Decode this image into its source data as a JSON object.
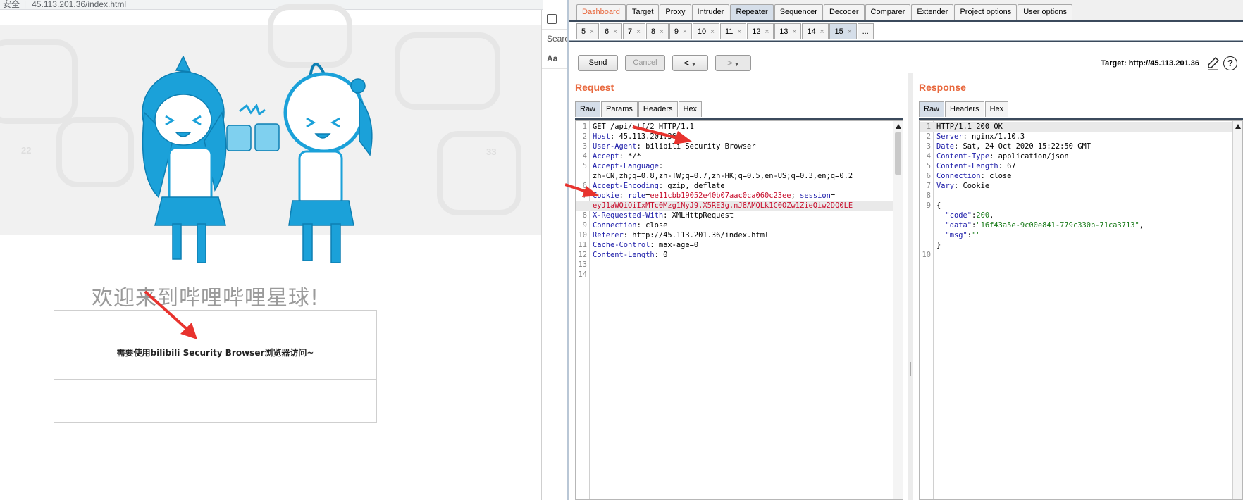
{
  "browser": {
    "url_prefix": "安全",
    "url": "45.113.201.36/index.html",
    "welcome": "欢迎来到哔哩哔哩星球!",
    "message": "需要使用bilibili Security Browser浏览器访问~",
    "devtools": {
      "search_label": "Searc",
      "aa_label": "Aa"
    }
  },
  "burp": {
    "main_tabs": [
      {
        "label": "Dashboard",
        "state": "alert"
      },
      {
        "label": "Target"
      },
      {
        "label": "Proxy"
      },
      {
        "label": "Intruder"
      },
      {
        "label": "Repeater",
        "state": "active"
      },
      {
        "label": "Sequencer"
      },
      {
        "label": "Decoder"
      },
      {
        "label": "Comparer"
      },
      {
        "label": "Extender"
      },
      {
        "label": "Project options"
      },
      {
        "label": "User options"
      }
    ],
    "repeater_tabs": [
      "5",
      "6",
      "7",
      "8",
      "9",
      "10",
      "11",
      "12",
      "13",
      "14",
      "15"
    ],
    "repeater_active": "15",
    "repeater_more": "...",
    "toolbar": {
      "send": "Send",
      "cancel": "Cancel",
      "back": "<",
      "forward": ">",
      "target_label": "Target: http://45.113.201.36"
    },
    "request": {
      "title": "Request",
      "tabs": [
        "Raw",
        "Params",
        "Headers",
        "Hex"
      ],
      "lines": [
        {
          "n": "1",
          "parts": [
            {
              "t": "GET /api/ctf/2 HTTP/1.1",
              "c": "v"
            }
          ]
        },
        {
          "n": "2",
          "parts": [
            {
              "t": "Host",
              "c": "k"
            },
            {
              "t": ": 45.113.201.36",
              "c": "v"
            }
          ]
        },
        {
          "n": "3",
          "parts": [
            {
              "t": "User-Agent",
              "c": "k"
            },
            {
              "t": ": bilibili Security Browser",
              "c": "v"
            }
          ]
        },
        {
          "n": "4",
          "parts": [
            {
              "t": "Accept",
              "c": "k"
            },
            {
              "t": ": */*",
              "c": "v"
            }
          ]
        },
        {
          "n": "5",
          "parts": [
            {
              "t": "Accept-Language",
              "c": "k"
            },
            {
              "t": ":",
              "c": "v"
            }
          ]
        },
        {
          "n": "",
          "parts": [
            {
              "t": "zh-CN,zh;q=0.8,zh-TW;q=0.7,zh-HK;q=0.5,en-US;q=0.3,en;q=0.2",
              "c": "v"
            }
          ]
        },
        {
          "n": "6",
          "parts": [
            {
              "t": "Accept-Encoding",
              "c": "k"
            },
            {
              "t": ": gzip, deflate",
              "c": "v"
            }
          ]
        },
        {
          "n": "7",
          "parts": [
            {
              "t": "Cookie",
              "c": "k"
            },
            {
              "t": ": ",
              "c": "v"
            },
            {
              "t": "role",
              "c": "k"
            },
            {
              "t": "=",
              "c": "v"
            },
            {
              "t": "ee11cbb19052e40b07aac0ca060c23ee",
              "c": "r"
            },
            {
              "t": "; ",
              "c": "v"
            },
            {
              "t": "session",
              "c": "k"
            },
            {
              "t": "=",
              "c": "v"
            }
          ]
        },
        {
          "n": "",
          "hl": true,
          "parts": [
            {
              "t": "eyJ1aWQiOiIxMTc0Mzg1NyJ9.X5RE3g.nJ8AMQLk1C0OZw1ZieQiw2DQ0LE",
              "c": "r"
            }
          ]
        },
        {
          "n": "8",
          "parts": [
            {
              "t": "X-Requested-With",
              "c": "k"
            },
            {
              "t": ": XMLHttpRequest",
              "c": "v"
            }
          ]
        },
        {
          "n": "9",
          "parts": [
            {
              "t": "Connection",
              "c": "k"
            },
            {
              "t": ": close",
              "c": "v"
            }
          ]
        },
        {
          "n": "10",
          "parts": [
            {
              "t": "Referer",
              "c": "k"
            },
            {
              "t": ": http://45.113.201.36/index.html",
              "c": "v"
            }
          ]
        },
        {
          "n": "11",
          "parts": [
            {
              "t": "Cache-Control",
              "c": "k"
            },
            {
              "t": ": max-age=0",
              "c": "v"
            }
          ]
        },
        {
          "n": "12",
          "parts": [
            {
              "t": "Content-Length",
              "c": "k"
            },
            {
              "t": ": 0",
              "c": "v"
            }
          ]
        },
        {
          "n": "13",
          "parts": []
        },
        {
          "n": "14",
          "parts": []
        }
      ]
    },
    "response": {
      "title": "Response",
      "tabs": [
        "Raw",
        "Headers",
        "Hex"
      ],
      "lines": [
        {
          "n": "1",
          "hl": true,
          "parts": [
            {
              "t": "HTTP/1.1 200 OK",
              "c": "v"
            }
          ]
        },
        {
          "n": "2",
          "parts": [
            {
              "t": "Server",
              "c": "k"
            },
            {
              "t": ": nginx/1.10.3",
              "c": "v"
            }
          ]
        },
        {
          "n": "3",
          "parts": [
            {
              "t": "Date",
              "c": "k"
            },
            {
              "t": ": Sat, 24 Oct 2020 15:22:50 GMT",
              "c": "v"
            }
          ]
        },
        {
          "n": "4",
          "parts": [
            {
              "t": "Content-Type",
              "c": "k"
            },
            {
              "t": ": application/json",
              "c": "v"
            }
          ]
        },
        {
          "n": "5",
          "parts": [
            {
              "t": "Content-Length",
              "c": "k"
            },
            {
              "t": ": 67",
              "c": "v"
            }
          ]
        },
        {
          "n": "6",
          "parts": [
            {
              "t": "Connection",
              "c": "k"
            },
            {
              "t": ": close",
              "c": "v"
            }
          ]
        },
        {
          "n": "7",
          "parts": [
            {
              "t": "Vary",
              "c": "k"
            },
            {
              "t": ": Cookie",
              "c": "v"
            }
          ]
        },
        {
          "n": "8",
          "parts": []
        },
        {
          "n": "9",
          "parts": [
            {
              "t": "{",
              "c": "v"
            }
          ]
        },
        {
          "n": "",
          "parts": [
            {
              "t": "  \"code\"",
              "c": "k"
            },
            {
              "t": ":",
              "c": "v"
            },
            {
              "t": "200",
              "c": "g"
            },
            {
              "t": ",",
              "c": "v"
            }
          ]
        },
        {
          "n": "",
          "parts": [
            {
              "t": "  \"data\"",
              "c": "k"
            },
            {
              "t": ":",
              "c": "v"
            },
            {
              "t": "\"16f43a5e-9c00e841-779c330b-71ca3713\"",
              "c": "g"
            },
            {
              "t": ",",
              "c": "v"
            }
          ]
        },
        {
          "n": "",
          "parts": [
            {
              "t": "  \"msg\"",
              "c": "k"
            },
            {
              "t": ":",
              "c": "v"
            },
            {
              "t": "\"\"",
              "c": "g"
            }
          ]
        },
        {
          "n": "",
          "parts": [
            {
              "t": "}",
              "c": "v"
            }
          ]
        },
        {
          "n": "10",
          "parts": []
        }
      ]
    }
  },
  "colors": {
    "accent_orange": "#e8673c",
    "syntax_key": "#1b1ba8",
    "syntax_cookie": "#c8102e",
    "syntax_json_value": "#1a7b1a",
    "mascot_blue": "#1ba1d9",
    "annotation_arrow": "#e8332e"
  },
  "icons": [
    "pencil-icon",
    "help-icon",
    "inspect-icon"
  ]
}
